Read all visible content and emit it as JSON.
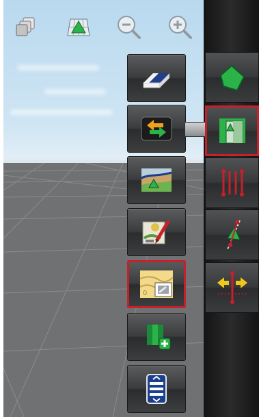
{
  "top_toolbar": {
    "icons": [
      "layers-icon",
      "field-map-icon",
      "zoom-out-icon",
      "zoom-in-icon"
    ]
  },
  "menu": {
    "items": [
      {
        "name": "eraser-icon",
        "selected": false
      },
      {
        "name": "swap-arrows-icon",
        "selected": false
      },
      {
        "name": "field-elevation-icon",
        "selected": false
      },
      {
        "name": "map-edit-icon",
        "selected": false
      },
      {
        "name": "field-boundary-map-icon",
        "selected": true
      },
      {
        "name": "add-section-icon",
        "selected": false
      },
      {
        "name": "scroll-icon",
        "selected": false
      }
    ]
  },
  "side_panel": {
    "items": [
      {
        "name": "field-polygon-icon",
        "selected": false
      },
      {
        "name": "headland-guidance-icon",
        "selected": true
      },
      {
        "name": "guidance-lines-icon",
        "selected": false
      },
      {
        "name": "guidance-steer-icon",
        "selected": false
      },
      {
        "name": "shift-line-icon",
        "selected": false
      }
    ]
  },
  "colors": {
    "highlight": "#c8202a",
    "green": "#2bb34a"
  }
}
